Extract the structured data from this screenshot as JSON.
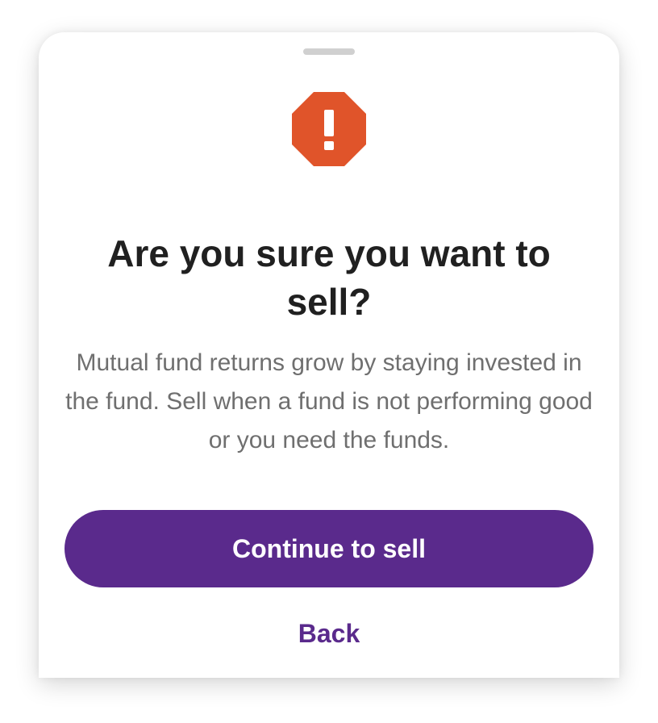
{
  "dialog": {
    "icon": "alert-octagon-icon",
    "title": "Are you sure you want to sell?",
    "message": "Mutual fund returns grow by staying invested in the fund. Sell when a fund is not performing good or you need the funds.",
    "primary_label": "Continue to sell",
    "secondary_label": "Back"
  },
  "colors": {
    "accent": "#5a2a8c",
    "warning": "#e0542a",
    "title_text": "#202020",
    "body_text": "#6f6f6f"
  }
}
